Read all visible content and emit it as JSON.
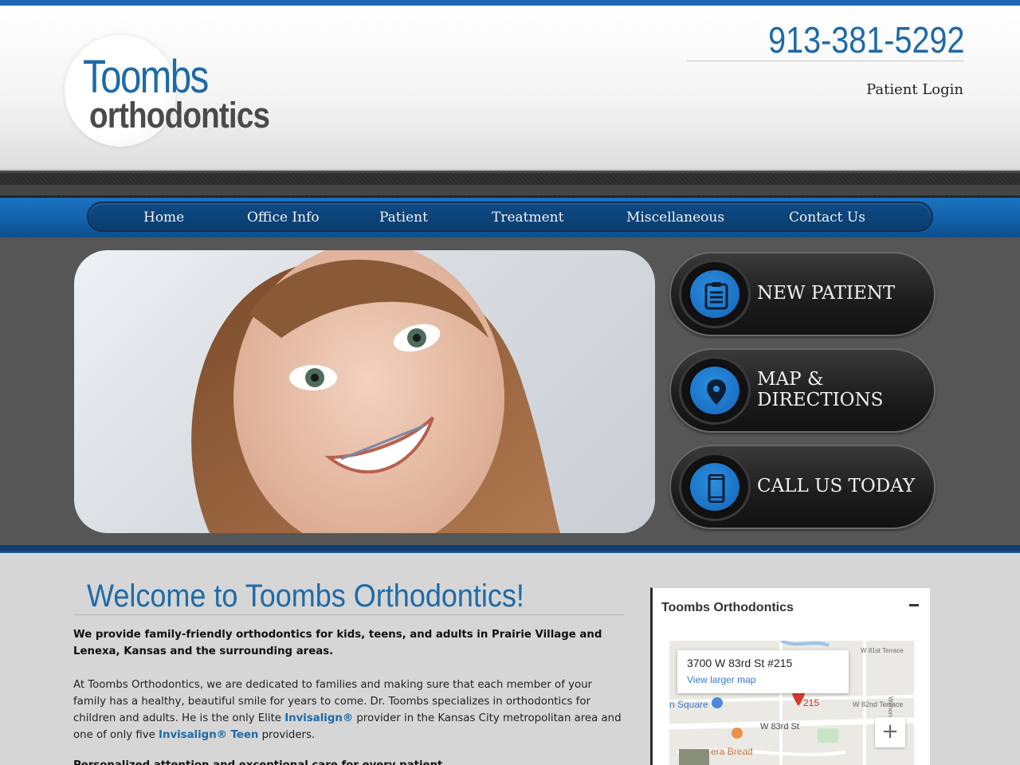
{
  "header": {
    "logo_line1": "Toombs",
    "logo_line2": "orthodontics",
    "phone": "913-381-5292",
    "login_label": "Patient Login"
  },
  "nav": {
    "items": [
      "Home",
      "Office Info",
      "Patient",
      "Treatment",
      "Miscellaneous",
      "Contact Us"
    ]
  },
  "cta": {
    "new_patient": "NEW PATIENT",
    "map_line1": "MAP &",
    "map_line2": "DIRECTIONS",
    "call": "CALL US TODAY"
  },
  "content": {
    "title": "Welcome to Toombs Orthodontics!",
    "intro_bold": "We provide family-friendly orthodontics for kids, teens, and adults in Prairie Village and Lenexa, Kansas and the surrounding areas.",
    "body_1": "At Toombs Orthodontics, we are dedicated to families and making sure that each member of your family has a healthy, beautiful smile for years to come. Dr. Toombs specializes in orthodontics for children and adults. He is the only Elite ",
    "link_invisalign": "Invisalign®",
    "body_2": " provider in the Kansas City metropolitan area and one of only five ",
    "link_invisalign_teen": "Invisalign® Teen",
    "body_3": " providers.",
    "cut_line": "Personalized attention and exceptional care for every patient"
  },
  "map_card": {
    "title": "Toombs Orthodontics",
    "address": "3700 W 83rd St #215",
    "view_larger": "View larger map",
    "pin_label": "215",
    "street_81": "W 81st Terrace",
    "street_82": "W 82nd Terrace",
    "street_83": "W 83rd St",
    "square": "n Square",
    "panera": "era Bread",
    "wenonga": "Wenonga Rd",
    "zoom_in": "+"
  },
  "colors": {
    "brand_blue": "#1d6aa8",
    "nav_blue": "#1463ad",
    "hero_gray": "#565656"
  }
}
